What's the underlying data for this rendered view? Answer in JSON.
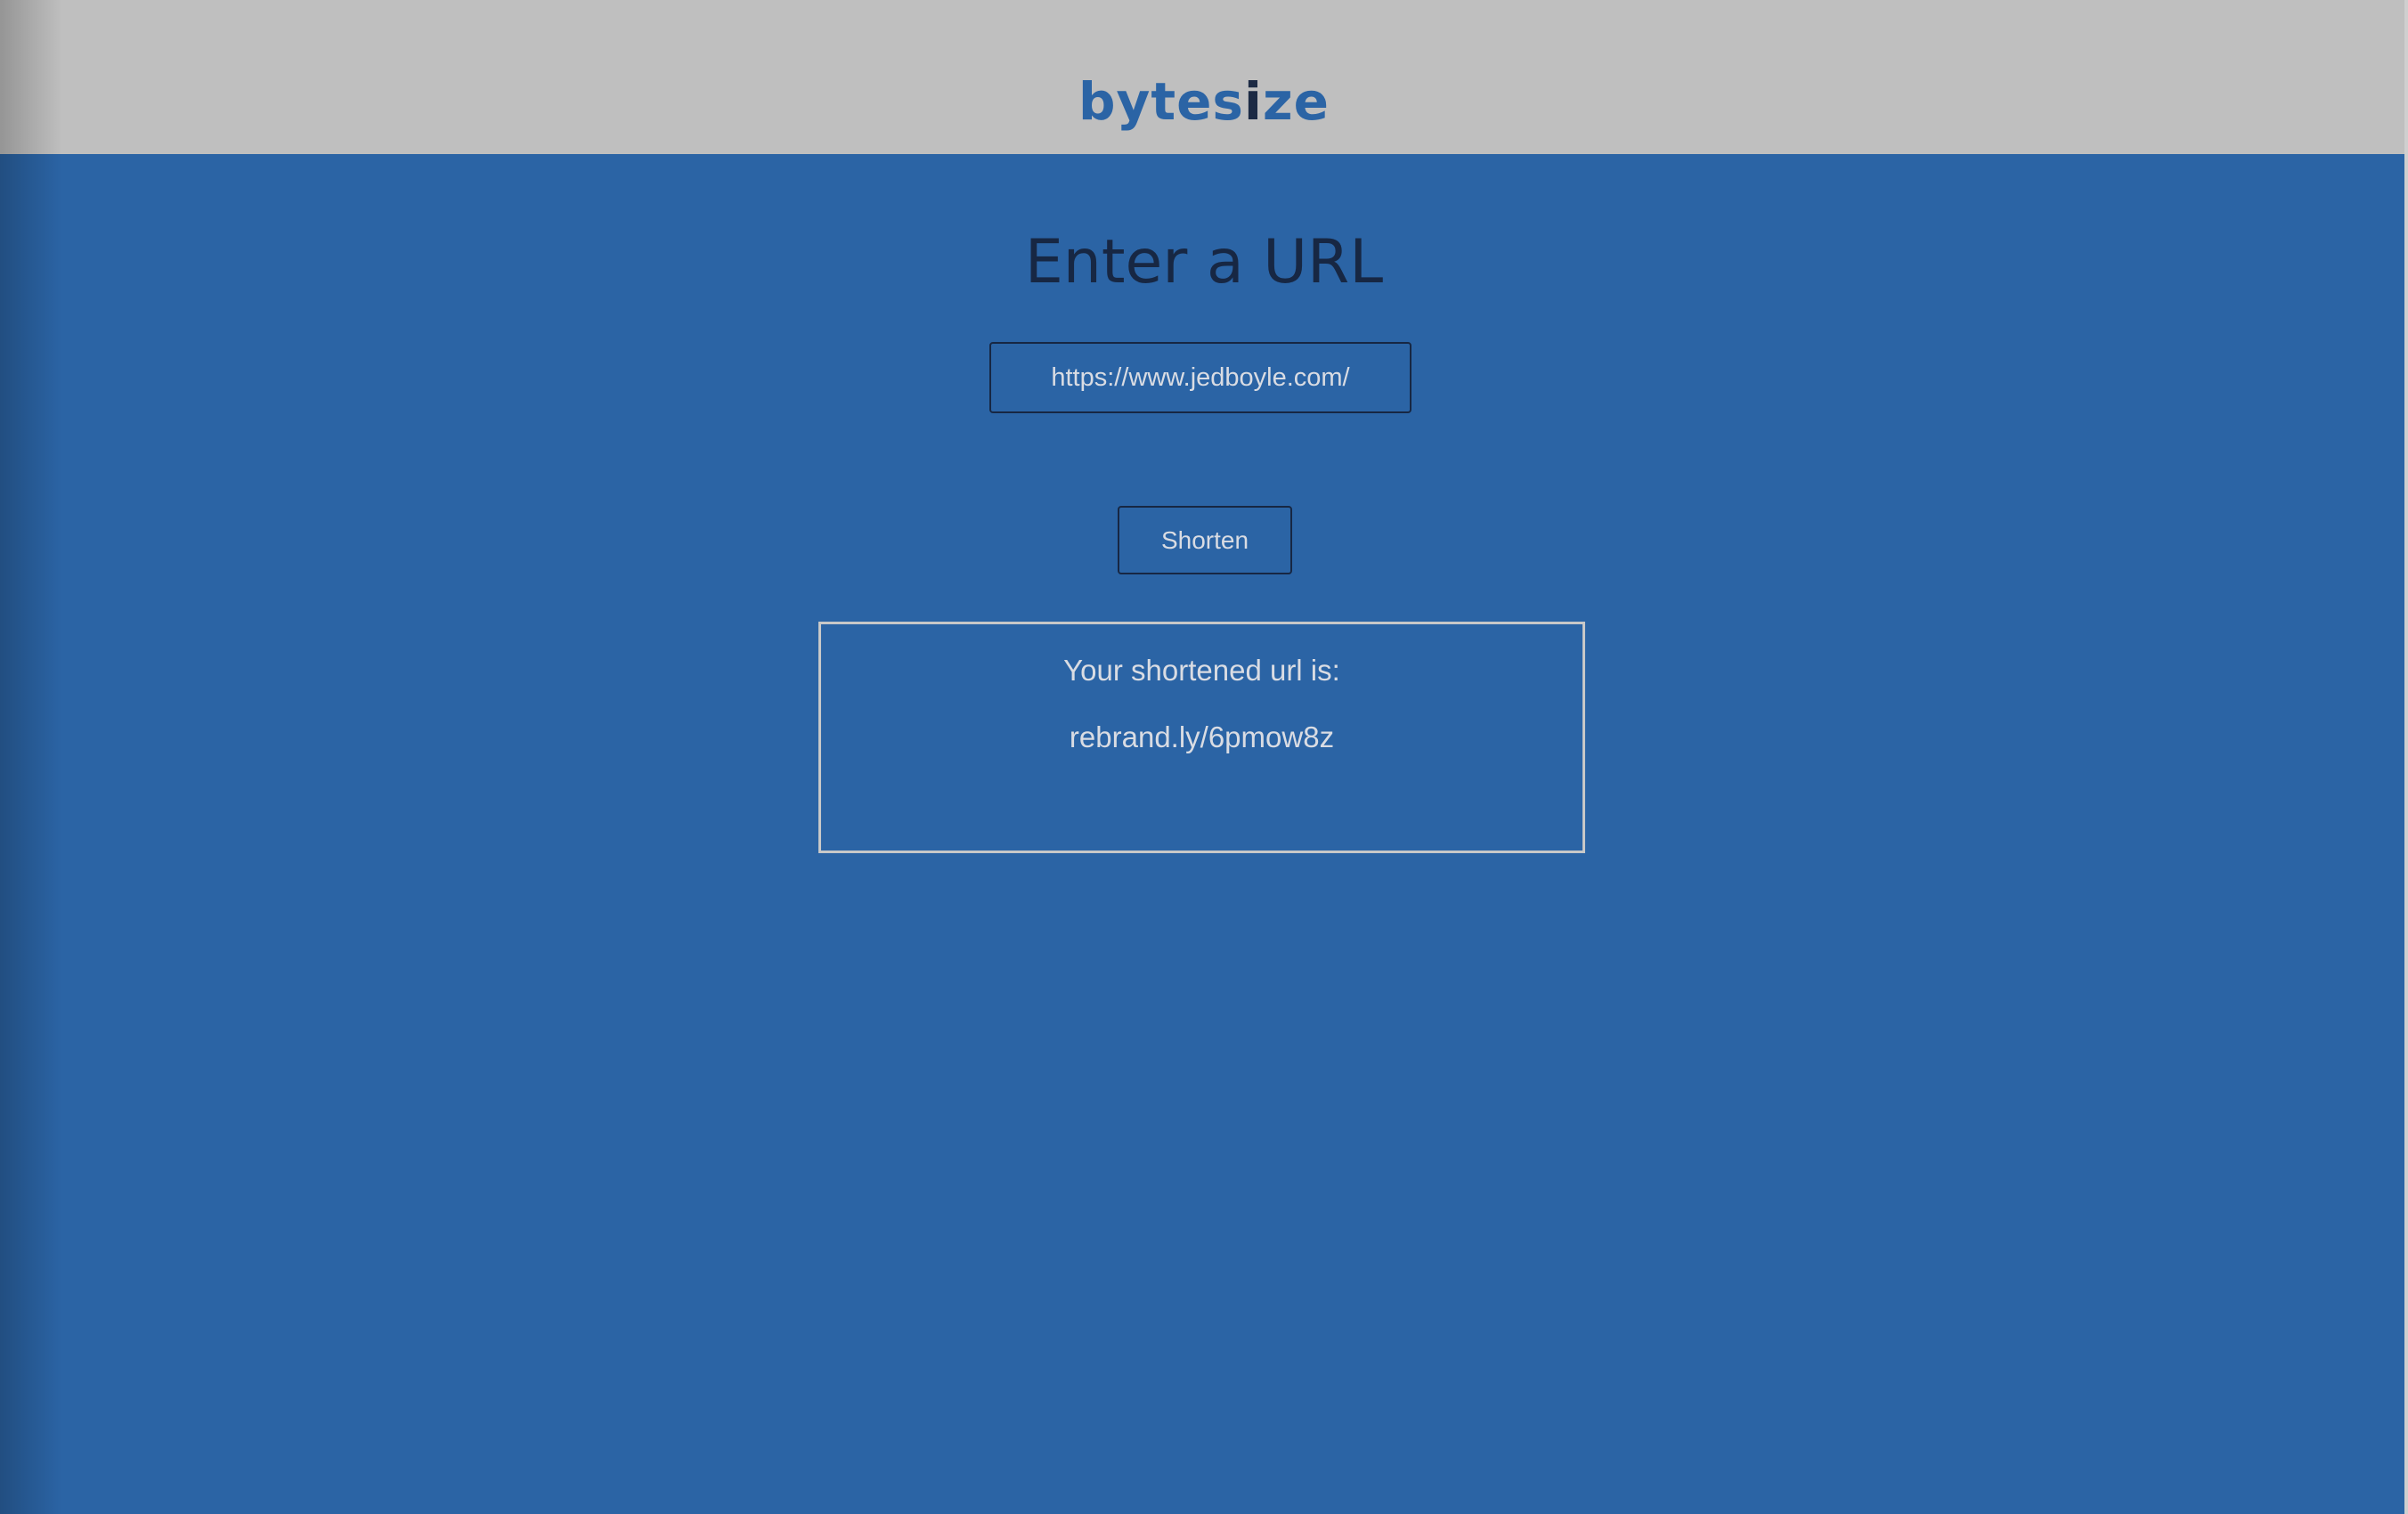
{
  "header": {
    "brand_before": "bytes",
    "brand_dot": "i",
    "brand_after": "ze"
  },
  "main": {
    "title": "Enter a URL",
    "url_input_value": "https://www.jedboyle.com/",
    "shorten_label": "Shorten",
    "result_label": "Your shortened url is:",
    "result_url": "rebrand.ly/6pmow8z"
  },
  "colors": {
    "header_bg": "#bfbfbf",
    "main_bg": "#2b64a5",
    "brand": "#2b64a5",
    "title": "#172743",
    "text_light": "#d9dce3"
  }
}
